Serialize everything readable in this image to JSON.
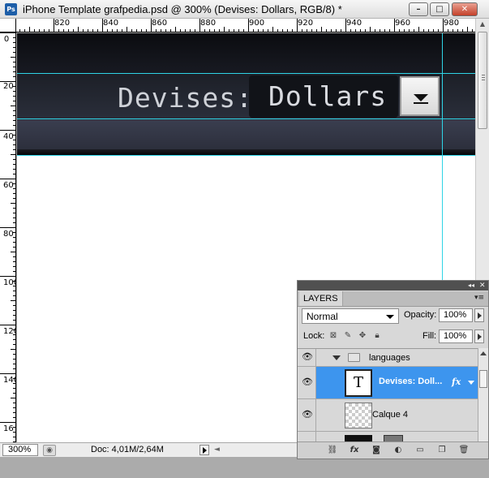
{
  "window": {
    "app_icon": "Ps",
    "title": "iPhone Template grafpedia.psd @ 300% (Devises:   Dollars, RGB/8) *",
    "buttons": {
      "minimize": "–",
      "maximize": "□",
      "close": "✕"
    }
  },
  "rulers": {
    "horizontal": [
      "820",
      "840",
      "860",
      "880",
      "900",
      "920",
      "940",
      "960",
      "980"
    ],
    "vertical": [
      "0",
      "20",
      "40",
      "60",
      "80",
      "100",
      "120",
      "140",
      "16"
    ]
  },
  "canvas": {
    "label": "Devises:",
    "value": "Dollars",
    "guide_color": "#2fd4e6"
  },
  "status": {
    "zoom": "300%",
    "doc": "Doc: 4,01M/2,64M"
  },
  "layers_panel": {
    "tab": "LAYERS",
    "blend_mode": "Normal",
    "opacity_label": "Opacity:",
    "opacity": "100%",
    "lock_label": "Lock:",
    "fill_label": "Fill:",
    "fill": "100%",
    "layers": [
      {
        "name": "languages",
        "type": "group"
      },
      {
        "name": "Devises:   Doll...",
        "type": "text",
        "selected": true,
        "fx": "fx"
      },
      {
        "name": "Calque 4",
        "type": "pixel"
      }
    ],
    "text_thumb": "T",
    "selected_color": "#3d95ee"
  }
}
